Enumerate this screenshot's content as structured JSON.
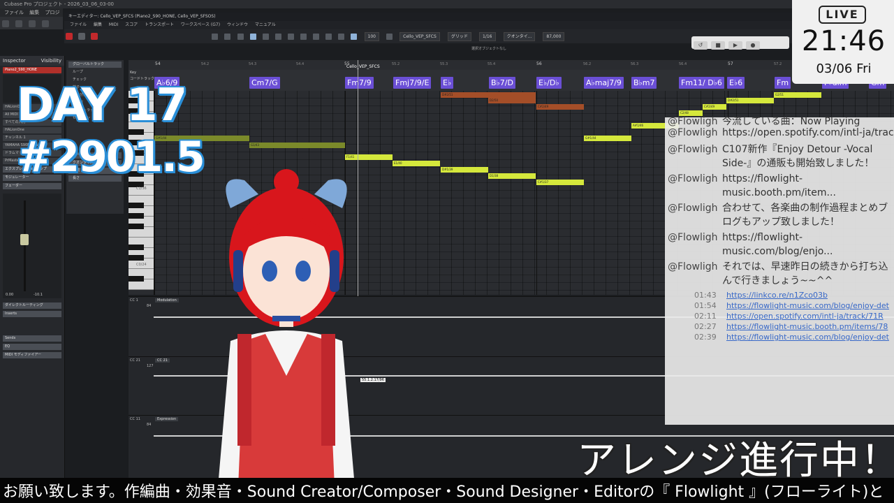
{
  "app": {
    "title": "Cubase Pro プロジェクト - 2026_03_06_03-00",
    "menu": [
      "ファイル",
      "編集",
      "プロジェクト"
    ]
  },
  "editor": {
    "title": "キーエディター: Cello_VEP_SFCS (Piano2_S90_HONE, Cello_VEP_SFSOS)",
    "menu": [
      "ファイル",
      "編集",
      "MIDI",
      "スコア",
      "トランスポート",
      "ワークスペース (G7)",
      "ウィンドウ",
      "マニュアル"
    ],
    "toolbar": {
      "zoom": "100",
      "part": "Cello_VEP_SFCS",
      "snap": "グリッド",
      "quantize": "1/16",
      "color": "クオンタイ...",
      "tempo": "87,000"
    },
    "status": "選択オブジェクトなし"
  },
  "inspector": {
    "tabs": [
      "Inspector",
      "Visibility"
    ],
    "track_name": "Piano2_S90_HONE",
    "instrument": "HALionOne",
    "rows": [
      "All MIDI Inputs",
      "すべての入力",
      "HALionOne",
      "チャンネル 1",
      "YAMAHA S90ES Piano",
      "ドラムマップなし",
      "PrMaster"
    ],
    "sections": [
      "エクスプレッションマップ",
      "モジュレーター",
      "フェーダー",
      "ダイレクトルーティング",
      "Inserts",
      "Sends",
      "EQ",
      "MIDI モディファイアー"
    ],
    "fader_values": [
      "0.00",
      "-10.1"
    ]
  },
  "global_tracks": {
    "header": "グローバルトラック",
    "items": [
      "ループ",
      "チェック",
      "拍子",
      "拍子分割",
      "テンポ",
      "コードトラック",
      "セクション"
    ],
    "sections": [
      "コードエディット",
      "クオンタイズ",
      "移調",
      "長さ"
    ]
  },
  "ruler": {
    "bars": [
      "54",
      "54.2",
      "54.3",
      "54.4",
      "55",
      "55.2",
      "55.3",
      "55.4",
      "56",
      "56.2",
      "56.3",
      "56.4",
      "57",
      "57.2"
    ],
    "part_label": "Cello_VEP_SFCS",
    "lane_labels": [
      "Key",
      "コードトラック"
    ]
  },
  "chords": [
    "A♭6/9",
    "Cm7/G",
    "Fm7/9",
    "Fmj7/9/E",
    "E♭",
    "B♭7/D",
    "E♭/D♭",
    "A♭maj7/9",
    "B♭m7",
    "Fm11/ D♭6",
    "E♭6",
    "Fm",
    "F♯dim",
    "Gm"
  ],
  "piano_labels": [
    "C2",
    "C1/36",
    "C0/24"
  ],
  "notes": [
    {
      "label": "G#1/44",
      "color": "olive"
    },
    {
      "label": "G1/43",
      "color": "olive"
    },
    {
      "label": "F1/41",
      "color": "lime"
    },
    {
      "label": "E1/40",
      "color": "lime"
    },
    {
      "label": "D#1/39",
      "color": "lime"
    },
    {
      "label": "D1/38",
      "color": "lime"
    },
    {
      "label": "C#1/37",
      "color": "lime"
    },
    {
      "label": "D#2/51",
      "color": "brown"
    },
    {
      "label": "D2/50",
      "color": "brown"
    },
    {
      "label": "C#2/49",
      "color": "brown"
    },
    {
      "label": "G#1/44",
      "color": "lime"
    },
    {
      "label": "A#1/46",
      "color": "lime"
    },
    {
      "label": "C2/48",
      "color": "lime"
    },
    {
      "label": "C#2/49",
      "color": "lime"
    },
    {
      "label": "D#2/51",
      "color": "lime"
    },
    {
      "label": "G2/51",
      "color": "lime"
    }
  ],
  "controllers": [
    {
      "cc": "CC 1",
      "value": "84",
      "name": "Modulation"
    },
    {
      "cc": "CC 21",
      "value": "127",
      "name": "CC 21"
    },
    {
      "cc": "CC 11",
      "value": "84",
      "name": "Expression"
    }
  ],
  "tooltip": "55.1.2.17/96",
  "live": {
    "badge": "LIVE",
    "time": "21:46",
    "date": "03/06 Fri"
  },
  "overlay": {
    "day": "DAY 17",
    "episode": "#2901.5",
    "arrange": "アレンジ進行中！"
  },
  "chat": [
    {
      "user": "@Flowlight",
      "text": "今流している曲：Now Playing"
    },
    {
      "user": "@Flowlight",
      "text": "https://open.spotify.com/intl-ja/trac"
    },
    {
      "user": "@Flowlight",
      "text": "C107新作『Enjoy Detour -Vocal Side-』の通販も開始致しました！"
    },
    {
      "user": "@Flowlight",
      "text": "https://flowlight-music.booth.pm/item..."
    },
    {
      "user": "@Flowlight",
      "text": "合わせて、各楽曲の制作過程まとめブログもアップ致しました！"
    },
    {
      "user": "@Flowlight",
      "text": "https://flowlight-music.com/blog/enjo..."
    },
    {
      "user": "@Flowlight",
      "text": "それでは、早速昨日の続きから打ち込んで行きましょう~~^^"
    }
  ],
  "chapters": [
    {
      "time": "01:43",
      "url": "https://linkco.re/n1Zco03b"
    },
    {
      "time": "01:54",
      "url": "https://flowlight-music.com/blog/enjoy-det"
    },
    {
      "time": "02:11",
      "url": "https://open.spotify.com/intl-ja/track/71R"
    },
    {
      "time": "02:27",
      "url": "https://flowlight-music.booth.pm/items/78"
    },
    {
      "time": "02:39",
      "url": "https://flowlight-music.com/blog/enjoy-det"
    }
  ],
  "ticker": "お願い致します。作編曲・効果音・Sound Creator/Composer・Sound Designer・Editorの『 Flowlight 』(フローライト)と",
  "colors": {
    "chord": "#6b4fd6",
    "note_lime": "#d5e83c",
    "note_olive": "#7b8a2a",
    "note_brown": "#a44e28",
    "day_outline": "#2a8fd8"
  }
}
